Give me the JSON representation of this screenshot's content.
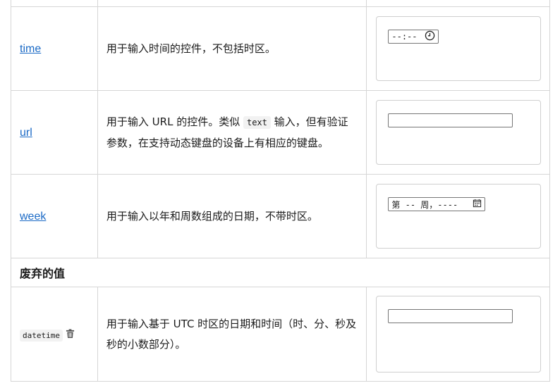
{
  "rows": [
    {
      "name": "time",
      "description": "用于输入时间的控件，不包括时区。",
      "demo": {
        "value": "--:--",
        "icon": "clock-icon"
      }
    },
    {
      "name": "url",
      "description_part1": "用于输入 URL 的控件。类似 ",
      "code": "text",
      "description_part2": " 输入，但有验证参数，在支持动态键盘的设备上有相应的键盘。",
      "demo": {
        "value": ""
      }
    },
    {
      "name": "week",
      "description": "用于输入以年和周数组成的日期，不带时区。",
      "demo": {
        "value": "第 -- 周，----",
        "icon": "calendar-icon"
      }
    }
  ],
  "section": {
    "title": "废弃的值"
  },
  "deprecated_rows": [
    {
      "name": "datetime",
      "description": "用于输入基于 UTC 时区的日期和时间（时、分、秒及秒的小数部分）。",
      "icon": "trash-icon",
      "demo": {
        "value": ""
      }
    }
  ]
}
